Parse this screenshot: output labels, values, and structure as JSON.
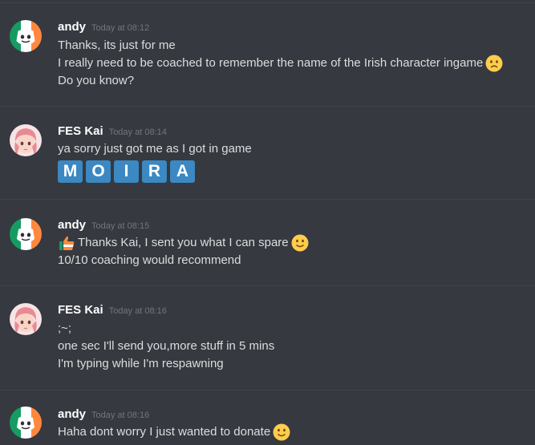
{
  "messages": [
    {
      "author": "andy",
      "timestamp": "Today at 08:12",
      "lines": [
        "Thanks, its just for me",
        "I really need to be coached to remember the name of the Irish character ingame",
        "Do you know?"
      ]
    },
    {
      "author": "FES Kai",
      "timestamp": "Today at 08:14",
      "lines": [
        "ya sorry just got me as I got in game"
      ],
      "tiles": [
        "M",
        "O",
        "I",
        "R",
        "A"
      ]
    },
    {
      "author": "andy",
      "timestamp": "Today at 08:15",
      "lines": [
        "Thanks Kai, I sent you what I can spare",
        "10/10 coaching would recommend"
      ]
    },
    {
      "author": "FES Kai",
      "timestamp": "Today at 08:16",
      "lines": [
        ";~;",
        "one sec I'll send you,more stuff in 5 mins",
        "I'm typing while I'm respawning"
      ]
    },
    {
      "author": "andy",
      "timestamp": "Today at 08:16",
      "lines": [
        "Haha dont worry I just wanted to donate"
      ]
    }
  ],
  "icons": {
    "andy_avatar": "irish-flag-discord-avatar-icon",
    "kai_avatar": "anime-girl-avatar-icon",
    "frown": "frowning-face-emoji-icon",
    "thumbs": "irish-thumbs-up-emoji-icon",
    "smile": "slightly-smiling-face-emoji-icon"
  },
  "colors": {
    "background": "#36393f",
    "username": "#ffffff",
    "text": "#dcddde",
    "timestamp": "#72767d",
    "tile": "#3b88c3"
  }
}
